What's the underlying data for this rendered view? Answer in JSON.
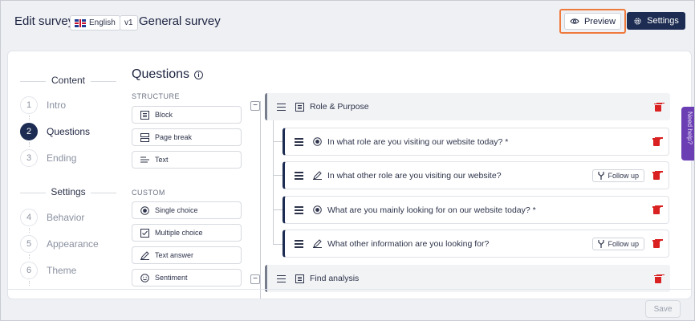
{
  "header": {
    "title": "Edit survey",
    "language": "English",
    "version": "v1",
    "survey_name": "General survey",
    "preview_label": "Preview",
    "settings_label": "Settings"
  },
  "nav": {
    "content_heading": "Content",
    "settings_heading": "Settings",
    "content_items": [
      {
        "num": "1",
        "label": "Intro"
      },
      {
        "num": "2",
        "label": "Questions"
      },
      {
        "num": "3",
        "label": "Ending"
      }
    ],
    "settings_items": [
      {
        "num": "4",
        "label": "Behavior"
      },
      {
        "num": "5",
        "label": "Appearance"
      },
      {
        "num": "6",
        "label": "Theme"
      }
    ]
  },
  "palette": {
    "title": "Questions",
    "structure_label": "STRUCTURE",
    "custom_label": "CUSTOM",
    "structure": [
      "Block",
      "Page break",
      "Text"
    ],
    "custom": [
      "Single choice",
      "Multiple choice",
      "Text answer",
      "Sentiment"
    ]
  },
  "tree": {
    "block1": "Role & Purpose",
    "questions": [
      {
        "label": "In what role are you visiting our website today? *",
        "type": "single-choice"
      },
      {
        "label": "In what other role are you visiting our website?",
        "type": "text-answer",
        "follow_up": "Follow up"
      },
      {
        "label": "What are you mainly looking for on our website today? *",
        "type": "single-choice"
      },
      {
        "label": "What other information are you looking for?",
        "type": "text-answer",
        "follow_up": "Follow up"
      }
    ],
    "block2": "Find analysis"
  },
  "side_tab": "Need help?",
  "footer": {
    "save_label": "Save"
  }
}
